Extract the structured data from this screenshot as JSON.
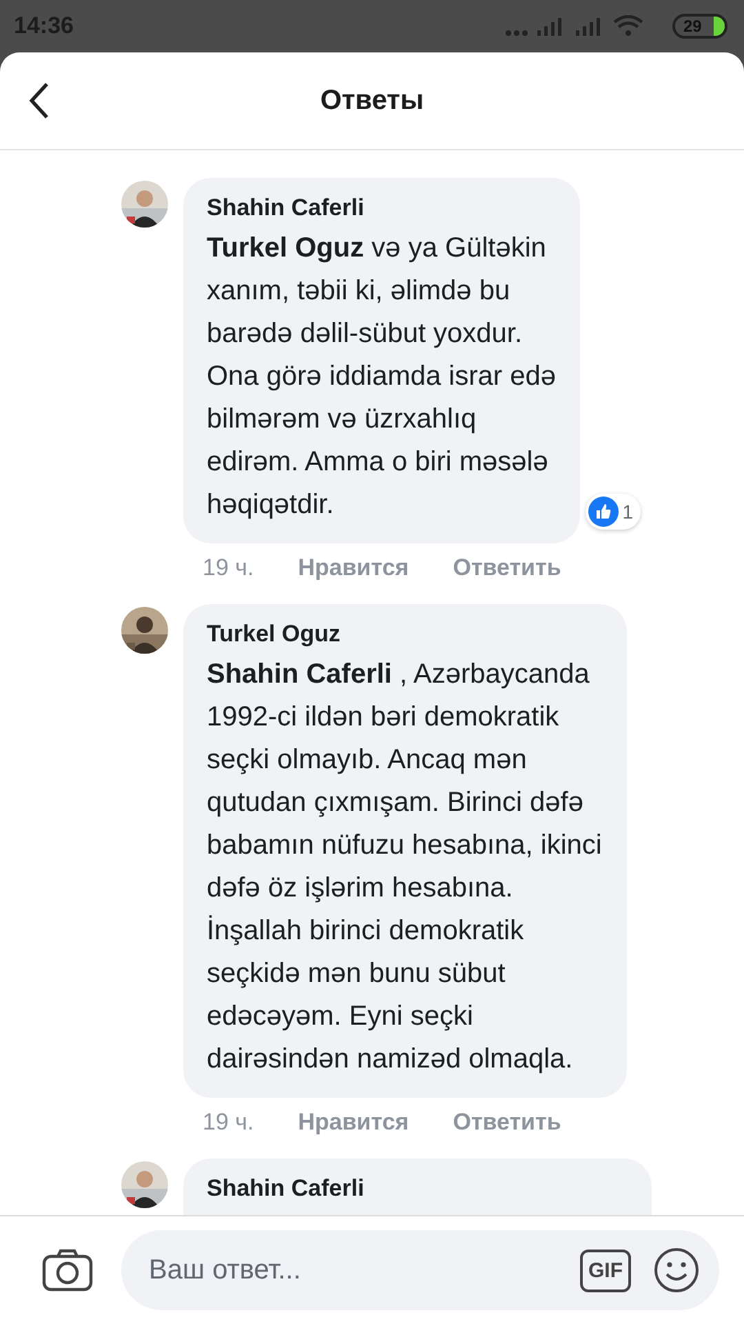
{
  "status_bar": {
    "time": "14:36",
    "battery": "29"
  },
  "header": {
    "title": "Ответы"
  },
  "comments": [
    {
      "author": "Shahin Caferli",
      "text": "**Turkel Oguz** və ya Gültəkin\nxanım, təbii ki, əlimdə bu\nbarədə dəlil-sübut yoxdur.\nOna görə iddiamda israr edə\nbilmərəm və üzrxahlıq\nedirəm. Amma o biri məsələ\nhəqiqətdir.",
      "reaction_count": "1",
      "time": "19 ч.",
      "like": "Нравится",
      "reply": "Ответить"
    },
    {
      "author": "Turkel Oguz",
      "text": "**Shahin Caferli** , Azərbaycanda\n1992-ci ildən bəri demokratik\nseçki olmayıb. Ancaq mən\nqutudan çıxmışam. Birinci dəfə\nbabamın nüfuzu hesabına, ikinci\ndəfə öz işlərim hesabına.\nİnşallah birinci demokratik\nseçkidə mən bunu sübut\nedəcəyəm. Eyni seçki\ndairəsindən namizəd olmaqla.",
      "time": "19 ч.",
      "like": "Нравится",
      "reply": "Ответить"
    },
    {
      "author": "Shahin Caferli"
    }
  ],
  "composer": {
    "placeholder": "Ваш ответ...",
    "gif_label": "GIF"
  }
}
